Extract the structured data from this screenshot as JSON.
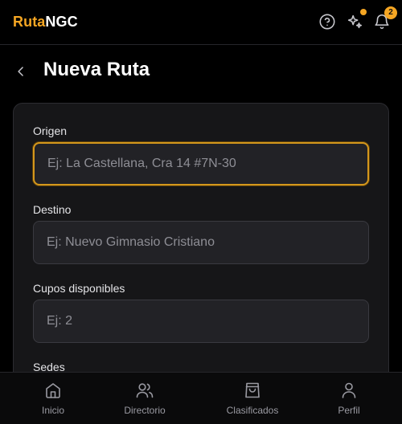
{
  "app": {
    "brand_accent": "Ruta",
    "brand_rest": "NGC",
    "notification_count": "2",
    "accent_color": "#f5a623",
    "icons": [
      "help-icon",
      "sparkles-icon",
      "bell-icon"
    ]
  },
  "header": {
    "title": "Nueva Ruta",
    "back_icon": "chevron-left-icon"
  },
  "form": {
    "origen": {
      "label": "Origen",
      "placeholder": "Ej: La Castellana, Cra 14 #7N-30",
      "value": ""
    },
    "destino": {
      "label": "Destino",
      "placeholder": "Ej: Nuevo Gimnasio Cristiano",
      "value": ""
    },
    "cupos": {
      "label": "Cupos disponibles",
      "placeholder": "Ej: 2",
      "value": ""
    },
    "sedes": {
      "label": "Sedes"
    }
  },
  "nav": {
    "items": [
      {
        "label": "Inicio",
        "icon": "home-icon"
      },
      {
        "label": "Directorio",
        "icon": "users-icon"
      },
      {
        "label": "Clasificados",
        "icon": "shopping-bag-icon"
      },
      {
        "label": "Perfil",
        "icon": "user-icon"
      }
    ]
  }
}
